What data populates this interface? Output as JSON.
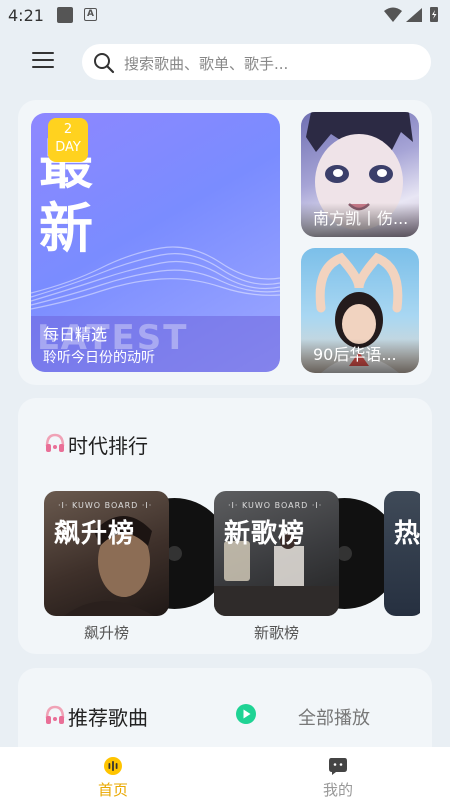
{
  "status": {
    "time": "4:21",
    "notif_letter": "A"
  },
  "search": {
    "placeholder": "搜索歌曲、歌单、歌手..."
  },
  "featured": {
    "badge_num": "2",
    "badge_unit": "DAY",
    "big_char_1": "最",
    "big_char_2": "新",
    "ghost_text": "LATEST",
    "title": "每日精选",
    "subtitle": "聆听今日份的动听"
  },
  "playlists": [
    {
      "label": "南方凯丨伤..."
    },
    {
      "label": "90后华语..."
    }
  ],
  "ranking": {
    "title": "时代排行",
    "cover_brand": "·I· KUWO BOARD ·I·",
    "items": [
      {
        "cover_title": "飙升榜",
        "name": "飙升榜"
      },
      {
        "cover_title": "新歌榜",
        "name": "新歌榜"
      },
      {
        "cover_title": "热"
      }
    ]
  },
  "recommend": {
    "title": "推荐歌曲",
    "play_all": "全部播放"
  },
  "tabs": [
    {
      "label": "首页"
    },
    {
      "label": "我的"
    }
  ],
  "colors": {
    "accent": "#ffc400",
    "play": "#1fd394",
    "tab_active": "#e9a800"
  }
}
